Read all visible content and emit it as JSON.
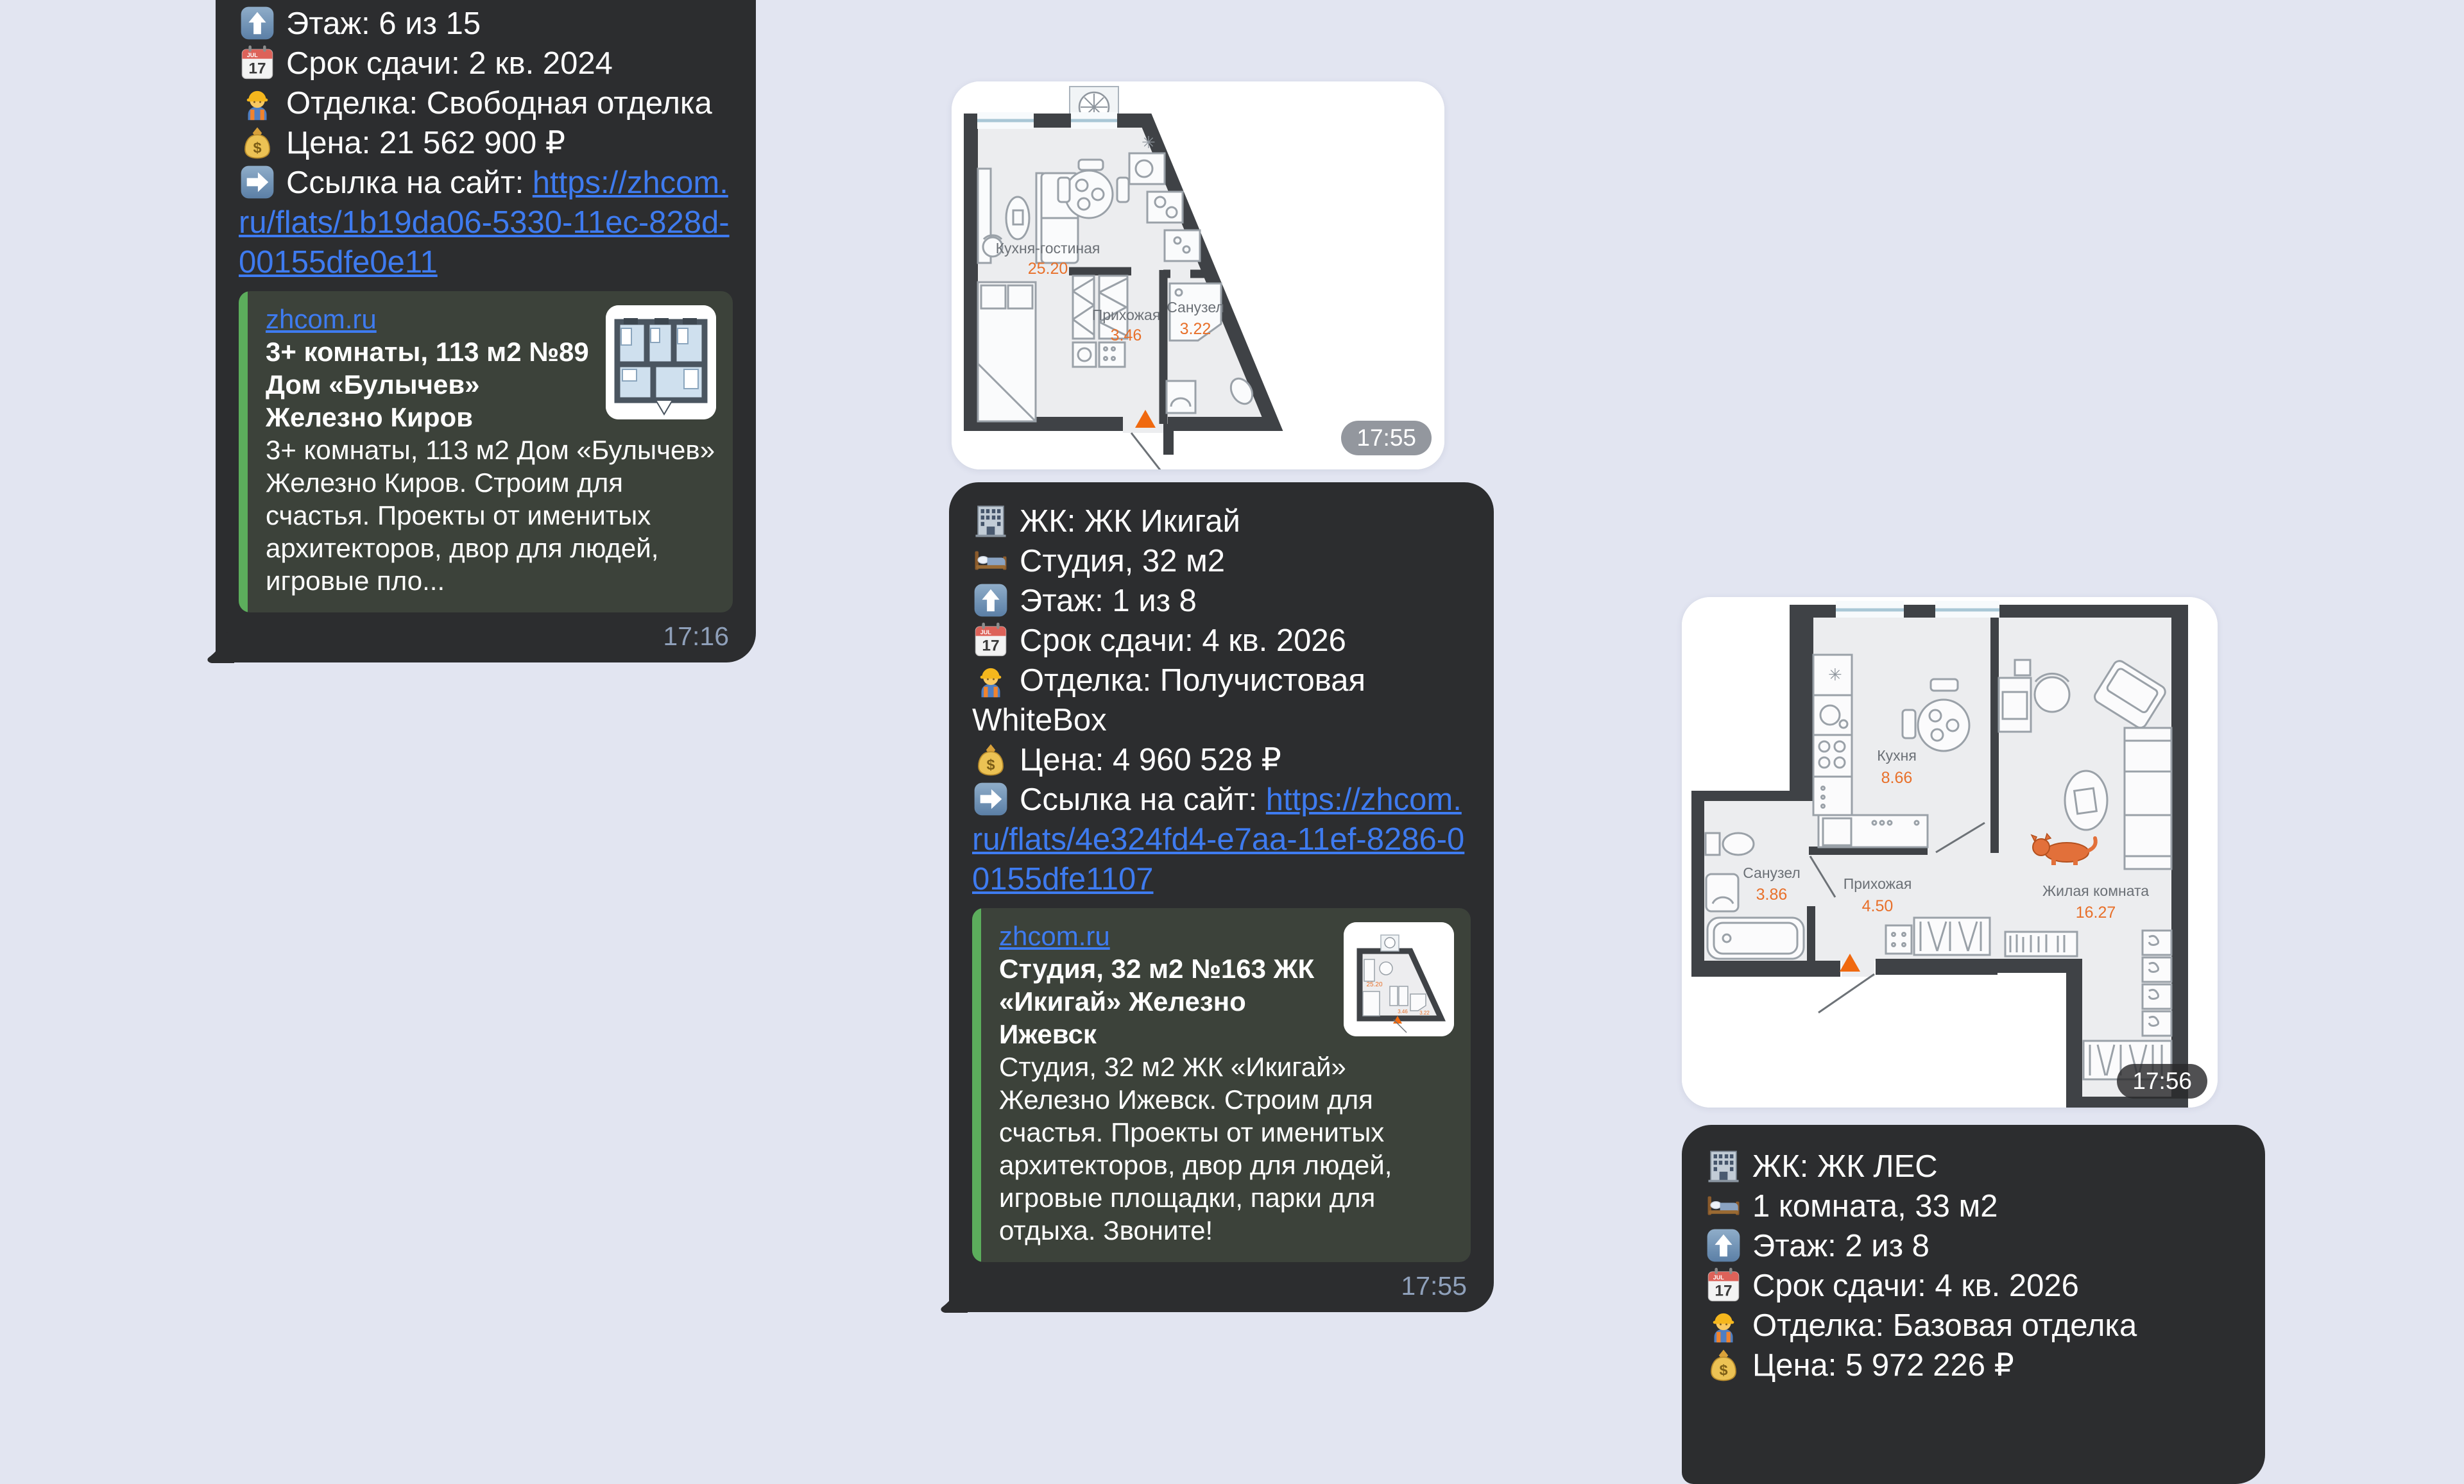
{
  "app": {
    "background_color": "#e2e5f1"
  },
  "colors": {
    "bubble": "#2c2d2f",
    "preview_background": "#3c423a",
    "accent_green": "#5cad5c",
    "link_blue": "#3e7bf0",
    "timestamp_gray": "#8fa0ba",
    "plan_number_orange": "#e8702a"
  },
  "icons": {
    "building-icon": "🏢",
    "bed-icon": "🛏",
    "up-arrow-icon": "⬆️",
    "calendar-icon": "📅",
    "worker-icon": "👷",
    "money-bag-icon": "💰",
    "right-arrow-icon": "➡️"
  },
  "messages": {
    "left": {
      "lines": [
        {
          "icon": "up-arrow-icon",
          "text": "Этаж: 6 из 15"
        },
        {
          "icon": "calendar-icon",
          "text": "Срок сдачи: 2 кв. 2024"
        },
        {
          "icon": "worker-icon",
          "text": "Отделка: Свободная отделка"
        },
        {
          "icon": "money-bag-icon",
          "text": "Цена: 21 562 900 ₽"
        },
        {
          "icon": "right-arrow-icon",
          "text": "Ссылка на сайт: ",
          "link": "https://zhcom.ru/flats/1b19da06-5330-11ec-828d-00155dfe0e11"
        }
      ],
      "preview": {
        "site": "zhcom.ru",
        "title": "3+ комнаты, 113 м2 №89 Дом «Булычев» Железно Киров",
        "description": "3+ комнаты, 113 м2 Дом «Булычев» Железно Киров. Строим для счастья. Проекты от именитых архитекторов, двор для людей, игровые пло...",
        "thumbnail": "blue-floorplan-thumbnail"
      },
      "time": "17:16"
    },
    "middle_photo": {
      "time": "17:55"
    },
    "middle": {
      "lines": [
        {
          "icon": "building-icon",
          "text": "ЖК: ЖК Икигай"
        },
        {
          "icon": "bed-icon",
          "text": "Студия, 32 м2"
        },
        {
          "icon": "up-arrow-icon",
          "text": "Этаж: 1 из 8"
        },
        {
          "icon": "calendar-icon",
          "text": "Срок сдачи: 4 кв. 2026"
        },
        {
          "icon": "worker-icon",
          "text": "Отделка: Получистовая WhiteBox"
        },
        {
          "icon": "money-bag-icon",
          "text": "Цена: 4 960 528 ₽"
        },
        {
          "icon": "right-arrow-icon",
          "text": "Ссылка на сайт: ",
          "link": "https://zhcom.ru/flats/4e324fd4-e7aa-11ef-8286-00155dfe1107"
        }
      ],
      "preview": {
        "site": "zhcom.ru",
        "title": "Студия, 32 м2 №163 ЖК «Икигай» Железно Ижевск",
        "description": "Студия, 32 м2 ЖК «Икигай» Железно Ижевск. Строим для счастья. Проекты от именитых архитекторов, двор для людей, игровые площадки, парки для отдыха. Звоните!",
        "thumbnail": "gray-floorplan-thumbnail"
      },
      "time": "17:55"
    },
    "right_photo": {
      "time": "17:56"
    },
    "right": {
      "lines": [
        {
          "icon": "building-icon",
          "text": "ЖК: ЖК ЛЕС"
        },
        {
          "icon": "bed-icon",
          "text": "1 комната, 33 м2"
        },
        {
          "icon": "up-arrow-icon",
          "text": "Этаж: 2 из 8"
        },
        {
          "icon": "calendar-icon",
          "text": "Срок сдачи: 4 кв. 2026"
        },
        {
          "icon": "worker-icon",
          "text": "Отделка: Базовая отделка"
        },
        {
          "icon": "money-bag-icon",
          "text": "Цена: 5 972 226 ₽"
        }
      ]
    }
  },
  "floorplans": {
    "studio": {
      "rooms": [
        {
          "name": "Кухня-гостиная",
          "area": "25.20"
        },
        {
          "name": "Прихожая",
          "area": "3.46"
        },
        {
          "name": "Санузел",
          "area": "3.22"
        }
      ]
    },
    "one_room": {
      "rooms": [
        {
          "name": "Кухня",
          "area": "8.66"
        },
        {
          "name": "Санузел",
          "area": "3.86"
        },
        {
          "name": "Прихожая",
          "area": "4.50"
        },
        {
          "name": "Жилая комната",
          "area": "16.27"
        }
      ]
    }
  }
}
